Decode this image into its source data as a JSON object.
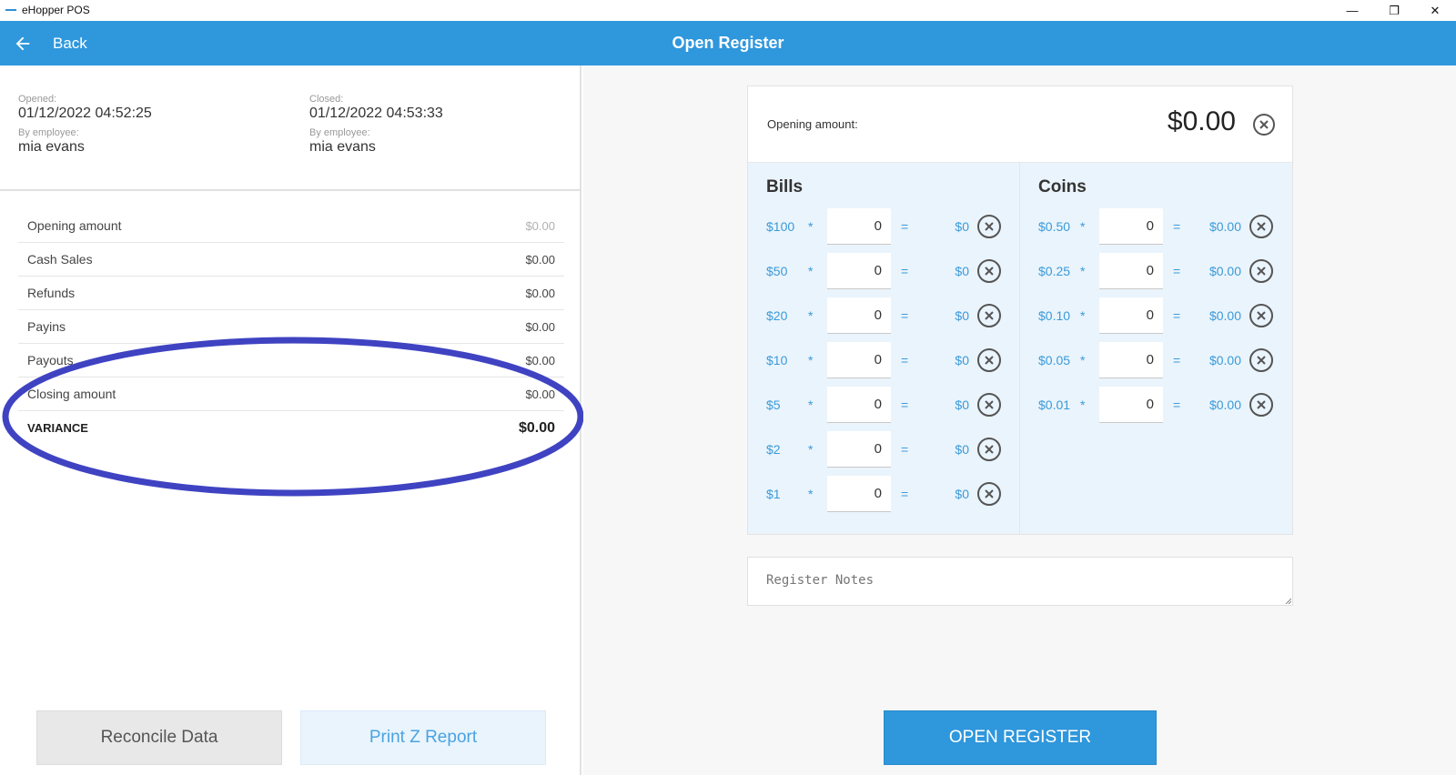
{
  "window": {
    "title": "eHopper POS",
    "minimize": "—",
    "maximize": "❐",
    "close": "✕"
  },
  "header": {
    "back_label": "Back",
    "title": "Open Register"
  },
  "meta": {
    "opened_label": "Opened:",
    "opened_value": "01/12/2022 04:52:25",
    "opened_by_label": "By employee:",
    "opened_by_value": "mia evans",
    "closed_label": "Closed:",
    "closed_value": "01/12/2022 04:53:33",
    "closed_by_label": "By employee:",
    "closed_by_value": "mia evans"
  },
  "summary": [
    {
      "label": "Opening amount",
      "amount": "$0.00"
    },
    {
      "label": "Cash Sales",
      "amount": "$0.00"
    },
    {
      "label": "Refunds",
      "amount": "$0.00"
    },
    {
      "label": "Payins",
      "amount": "$0.00"
    },
    {
      "label": "Payouts",
      "amount": "$0.00"
    },
    {
      "label": "Closing amount",
      "amount": "$0.00"
    },
    {
      "label": "VARIANCE",
      "amount": "$0.00"
    }
  ],
  "left_buttons": {
    "reconcile": "Reconcile Data",
    "print": "Print Z Report"
  },
  "opening": {
    "label": "Opening amount:",
    "amount": "$0.00"
  },
  "bills": {
    "title": "Bills",
    "rows": [
      {
        "denomination": "$100",
        "star": "*",
        "qty": "0",
        "eq": "=",
        "total": "$0"
      },
      {
        "denomination": "$50",
        "star": "*",
        "qty": "0",
        "eq": "=",
        "total": "$0"
      },
      {
        "denomination": "$20",
        "star": "*",
        "qty": "0",
        "eq": "=",
        "total": "$0"
      },
      {
        "denomination": "$10",
        "star": "*",
        "qty": "0",
        "eq": "=",
        "total": "$0"
      },
      {
        "denomination": "$5",
        "star": "*",
        "qty": "0",
        "eq": "=",
        "total": "$0"
      },
      {
        "denomination": "$2",
        "star": "*",
        "qty": "0",
        "eq": "=",
        "total": "$0"
      },
      {
        "denomination": "$1",
        "star": "*",
        "qty": "0",
        "eq": "=",
        "total": "$0"
      }
    ]
  },
  "coins": {
    "title": "Coins",
    "rows": [
      {
        "denomination": "$0.50",
        "star": "*",
        "qty": "0",
        "eq": "=",
        "total": "$0.00"
      },
      {
        "denomination": "$0.25",
        "star": "*",
        "qty": "0",
        "eq": "=",
        "total": "$0.00"
      },
      {
        "denomination": "$0.10",
        "star": "*",
        "qty": "0",
        "eq": "=",
        "total": "$0.00"
      },
      {
        "denomination": "$0.05",
        "star": "*",
        "qty": "0",
        "eq": "=",
        "total": "$0.00"
      },
      {
        "denomination": "$0.01",
        "star": "*",
        "qty": "0",
        "eq": "=",
        "total": "$0.00"
      }
    ]
  },
  "notes": {
    "placeholder": "Register Notes"
  },
  "open_button": "OPEN REGISTER",
  "colors": {
    "header_blue": "#2f97dc",
    "denom_blue": "#3b9ad9",
    "annotation": "#3f43c2"
  },
  "icons": {
    "back": "arrow-left-icon",
    "clear": "circle-x-icon"
  }
}
